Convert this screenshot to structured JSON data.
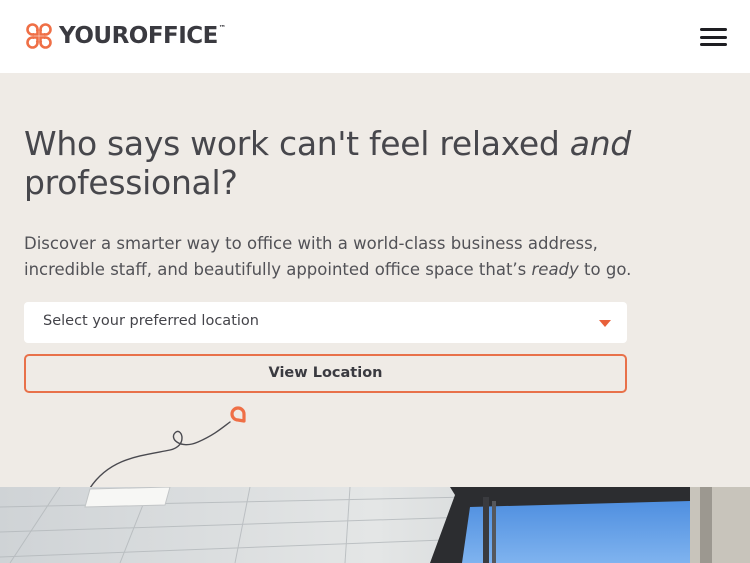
{
  "header": {
    "logo_text": "YOUROFFICE",
    "logo_tm": "™",
    "menu_icon": "hamburger-menu-icon"
  },
  "hero": {
    "title_part1": "Who says work can't feel relaxed ",
    "title_emphasis": "and",
    "title_part2": "professional?",
    "desc_part1": "Discover a smarter way to office with a world-class business address, incredible staff, and beautifully appointed office space that’s ",
    "desc_emphasis": "ready",
    "desc_part2": " to go."
  },
  "location_select": {
    "placeholder": "Select your preferred location",
    "caret_icon": "chevron-down-icon"
  },
  "view_button": {
    "label": "View Location"
  },
  "decor": {
    "doodle_icon": "location-pin-doodle-icon",
    "photo": "office-interior-photo"
  },
  "colors": {
    "accent": "#e8714a",
    "background": "#efebe6",
    "text": "#47474c"
  }
}
